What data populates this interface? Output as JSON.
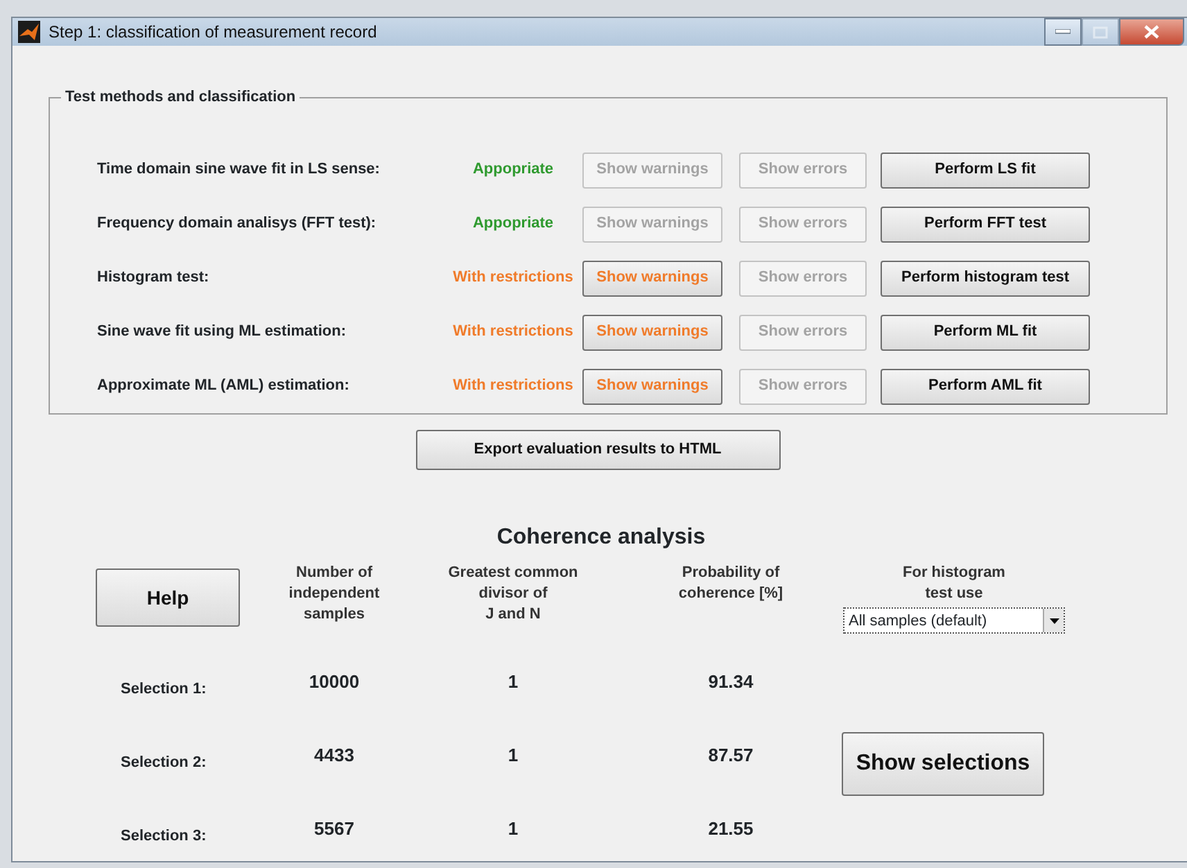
{
  "window": {
    "title": "Step 1: classification of measurement record",
    "controls": [
      {
        "kind": "minimize"
      },
      {
        "kind": "maximize",
        "disabled": true
      },
      {
        "kind": "close"
      }
    ]
  },
  "group": {
    "title": "Test methods and classification",
    "methods": [
      {
        "label": "Time domain sine wave fit in LS sense:",
        "status": "Appopriate",
        "kind": "ok",
        "warnings": {
          "label": "Show warnings",
          "disabled": true
        },
        "errors": {
          "label": "Show errors",
          "disabled": true
        },
        "perform": "Perform LS fit"
      },
      {
        "label": "Frequency domain analisys (FFT test):",
        "status": "Appopriate",
        "kind": "ok",
        "warnings": {
          "label": "Show warnings",
          "disabled": true
        },
        "errors": {
          "label": "Show errors",
          "disabled": true
        },
        "perform": "Perform FFT test"
      },
      {
        "label": "Histogram test:",
        "status": "With restrictions",
        "kind": "restricted",
        "warnings": {
          "label": "Show warnings",
          "disabled": false
        },
        "errors": {
          "label": "Show errors",
          "disabled": true
        },
        "perform": "Perform histogram test"
      },
      {
        "label": "Sine wave fit using ML estimation:",
        "status": "With restrictions",
        "kind": "restricted",
        "warnings": {
          "label": "Show warnings",
          "disabled": false
        },
        "errors": {
          "label": "Show errors",
          "disabled": true
        },
        "perform": "Perform ML fit"
      },
      {
        "label": "Approximate ML (AML) estimation:",
        "status": "With restrictions",
        "kind": "restricted",
        "warnings": {
          "label": "Show warnings",
          "disabled": false
        },
        "errors": {
          "label": "Show errors",
          "disabled": true
        },
        "perform": "Perform AML fit"
      }
    ]
  },
  "export_button": "Export evaluation results to HTML",
  "coherence": {
    "title": "Coherence analysis",
    "help_button": "Help",
    "columns": [
      "Number of\nindependent\nsamples",
      "Greatest common\ndivisor of\nJ and N",
      "Probability of\ncoherence [%]"
    ],
    "histogram_label": "For histogram\ntest use",
    "histogram_select": "All samples (default)",
    "rows": [
      {
        "label": "Selection 1:",
        "samples": "10000",
        "gcd": "1",
        "probability": "91.34"
      },
      {
        "label": "Selection 2:",
        "samples": "4433",
        "gcd": "1",
        "probability": "87.57"
      },
      {
        "label": "Selection 3:",
        "samples": "5567",
        "gcd": "1",
        "probability": "21.55"
      }
    ],
    "show_selections_button": "Show selections"
  }
}
